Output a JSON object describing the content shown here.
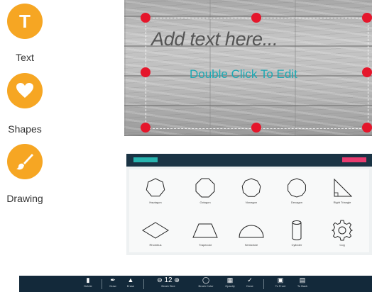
{
  "tools": [
    {
      "label": "Text",
      "icon": "text-icon"
    },
    {
      "label": "Shapes",
      "icon": "heart-icon"
    },
    {
      "label": "Drawing",
      "icon": "brush-icon"
    }
  ],
  "canvas": {
    "placeholder_text": "Add text here...",
    "hint_text": "Double Click To Edit",
    "handle_color": "#e5162b",
    "hint_color": "#1ea9b4"
  },
  "shapes_panel": {
    "left_button_color": "#27b3ae",
    "right_button_color": "#e83a6e",
    "shapes": [
      {
        "label": "Heptagon",
        "icon": "heptagon-icon"
      },
      {
        "label": "Octagon",
        "icon": "octagon-icon"
      },
      {
        "label": "Nonagon",
        "icon": "nonagon-icon"
      },
      {
        "label": "Decagon",
        "icon": "decagon-icon"
      },
      {
        "label": "Right Triangle",
        "icon": "right-triangle-icon"
      },
      {
        "label": "Rhombus",
        "icon": "rhombus-icon"
      },
      {
        "label": "Trapezoid",
        "icon": "trapezoid-icon"
      },
      {
        "label": "Semicircle",
        "icon": "semicircle-icon"
      },
      {
        "label": "Cylinder",
        "icon": "cylinder-icon"
      },
      {
        "label": "Cog",
        "icon": "cog-icon"
      }
    ]
  },
  "toolbar": {
    "delete": "Delete",
    "draw": "Draw",
    "erase": "Erase",
    "brush_size_value": "12",
    "brush_size_label": "Brush Size",
    "brush_color": "Brush Color",
    "opacity": "Opacity",
    "done": "Done",
    "to_front": "To Front",
    "to_back": "To Back"
  }
}
